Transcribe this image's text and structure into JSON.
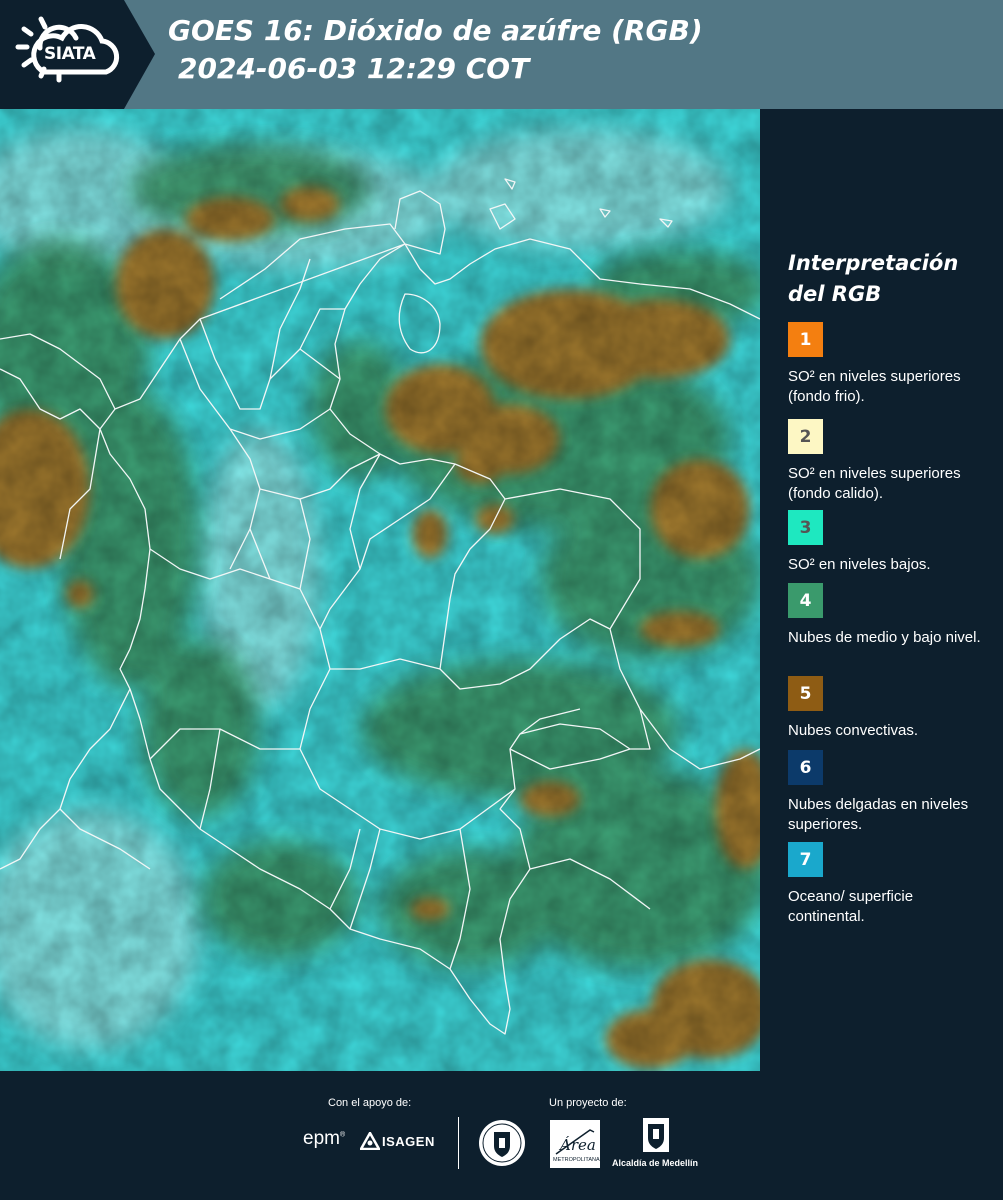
{
  "header": {
    "logo_text": "SIATA",
    "title_line1": "GOES 16: Dióxido de azúfre (RGB)",
    "title_line2": "2024-06-03 12:29 COT"
  },
  "legend": {
    "title_line1": "Interpretación",
    "title_line2": "del RGB",
    "items": [
      {
        "number": "1",
        "color": "#f47f10",
        "number_color": "#ffffff",
        "text": "SO² en niveles superiores (fondo frio)."
      },
      {
        "number": "2",
        "color": "#fdf7c4",
        "number_color": "#555555",
        "text": "SO² en niveles superiores (fondo calido)."
      },
      {
        "number": "3",
        "color": "#1ee8c0",
        "number_color": "#555555",
        "text": "SO² en niveles bajos."
      },
      {
        "number": "4",
        "color": "#3a9a6c",
        "number_color": "#ffffff",
        "text": "Nubes de medio y bajo nivel."
      },
      {
        "number": "5",
        "color": "#8e5c14",
        "number_color": "#ffffff",
        "text": "Nubes convectivas."
      },
      {
        "number": "6",
        "color": "#0c3a6a",
        "number_color": "#ffffff",
        "text": "Nubes delgadas en niveles superiores."
      },
      {
        "number": "7",
        "color": "#1aa8cc",
        "number_color": "#ffffff",
        "text": "Oceano/ superficie continental."
      }
    ]
  },
  "footer": {
    "support_label": "Con el apoyo de:",
    "project_label": "Un proyecto de:",
    "sponsor_epm": "epm",
    "sponsor_isagen": "ISAGEN",
    "alcaldia": "Alcaldía de Medellín",
    "metro_name": "Área",
    "metro_sub": "METROPOLITANA"
  },
  "colors": {
    "header_band": "#527785",
    "page_background": "#0d1f2d",
    "surface_cyan": "#36ddde",
    "cloud_green": "#3a9a6c",
    "cloud_brown": "#a07a2c"
  },
  "icons": {
    "logo": "siata-sun-cloud-icon",
    "isagen": "isagen-triangle-icon",
    "seal": "medellin-seal-icon",
    "alcaldia": "alcaldia-crest-icon"
  }
}
